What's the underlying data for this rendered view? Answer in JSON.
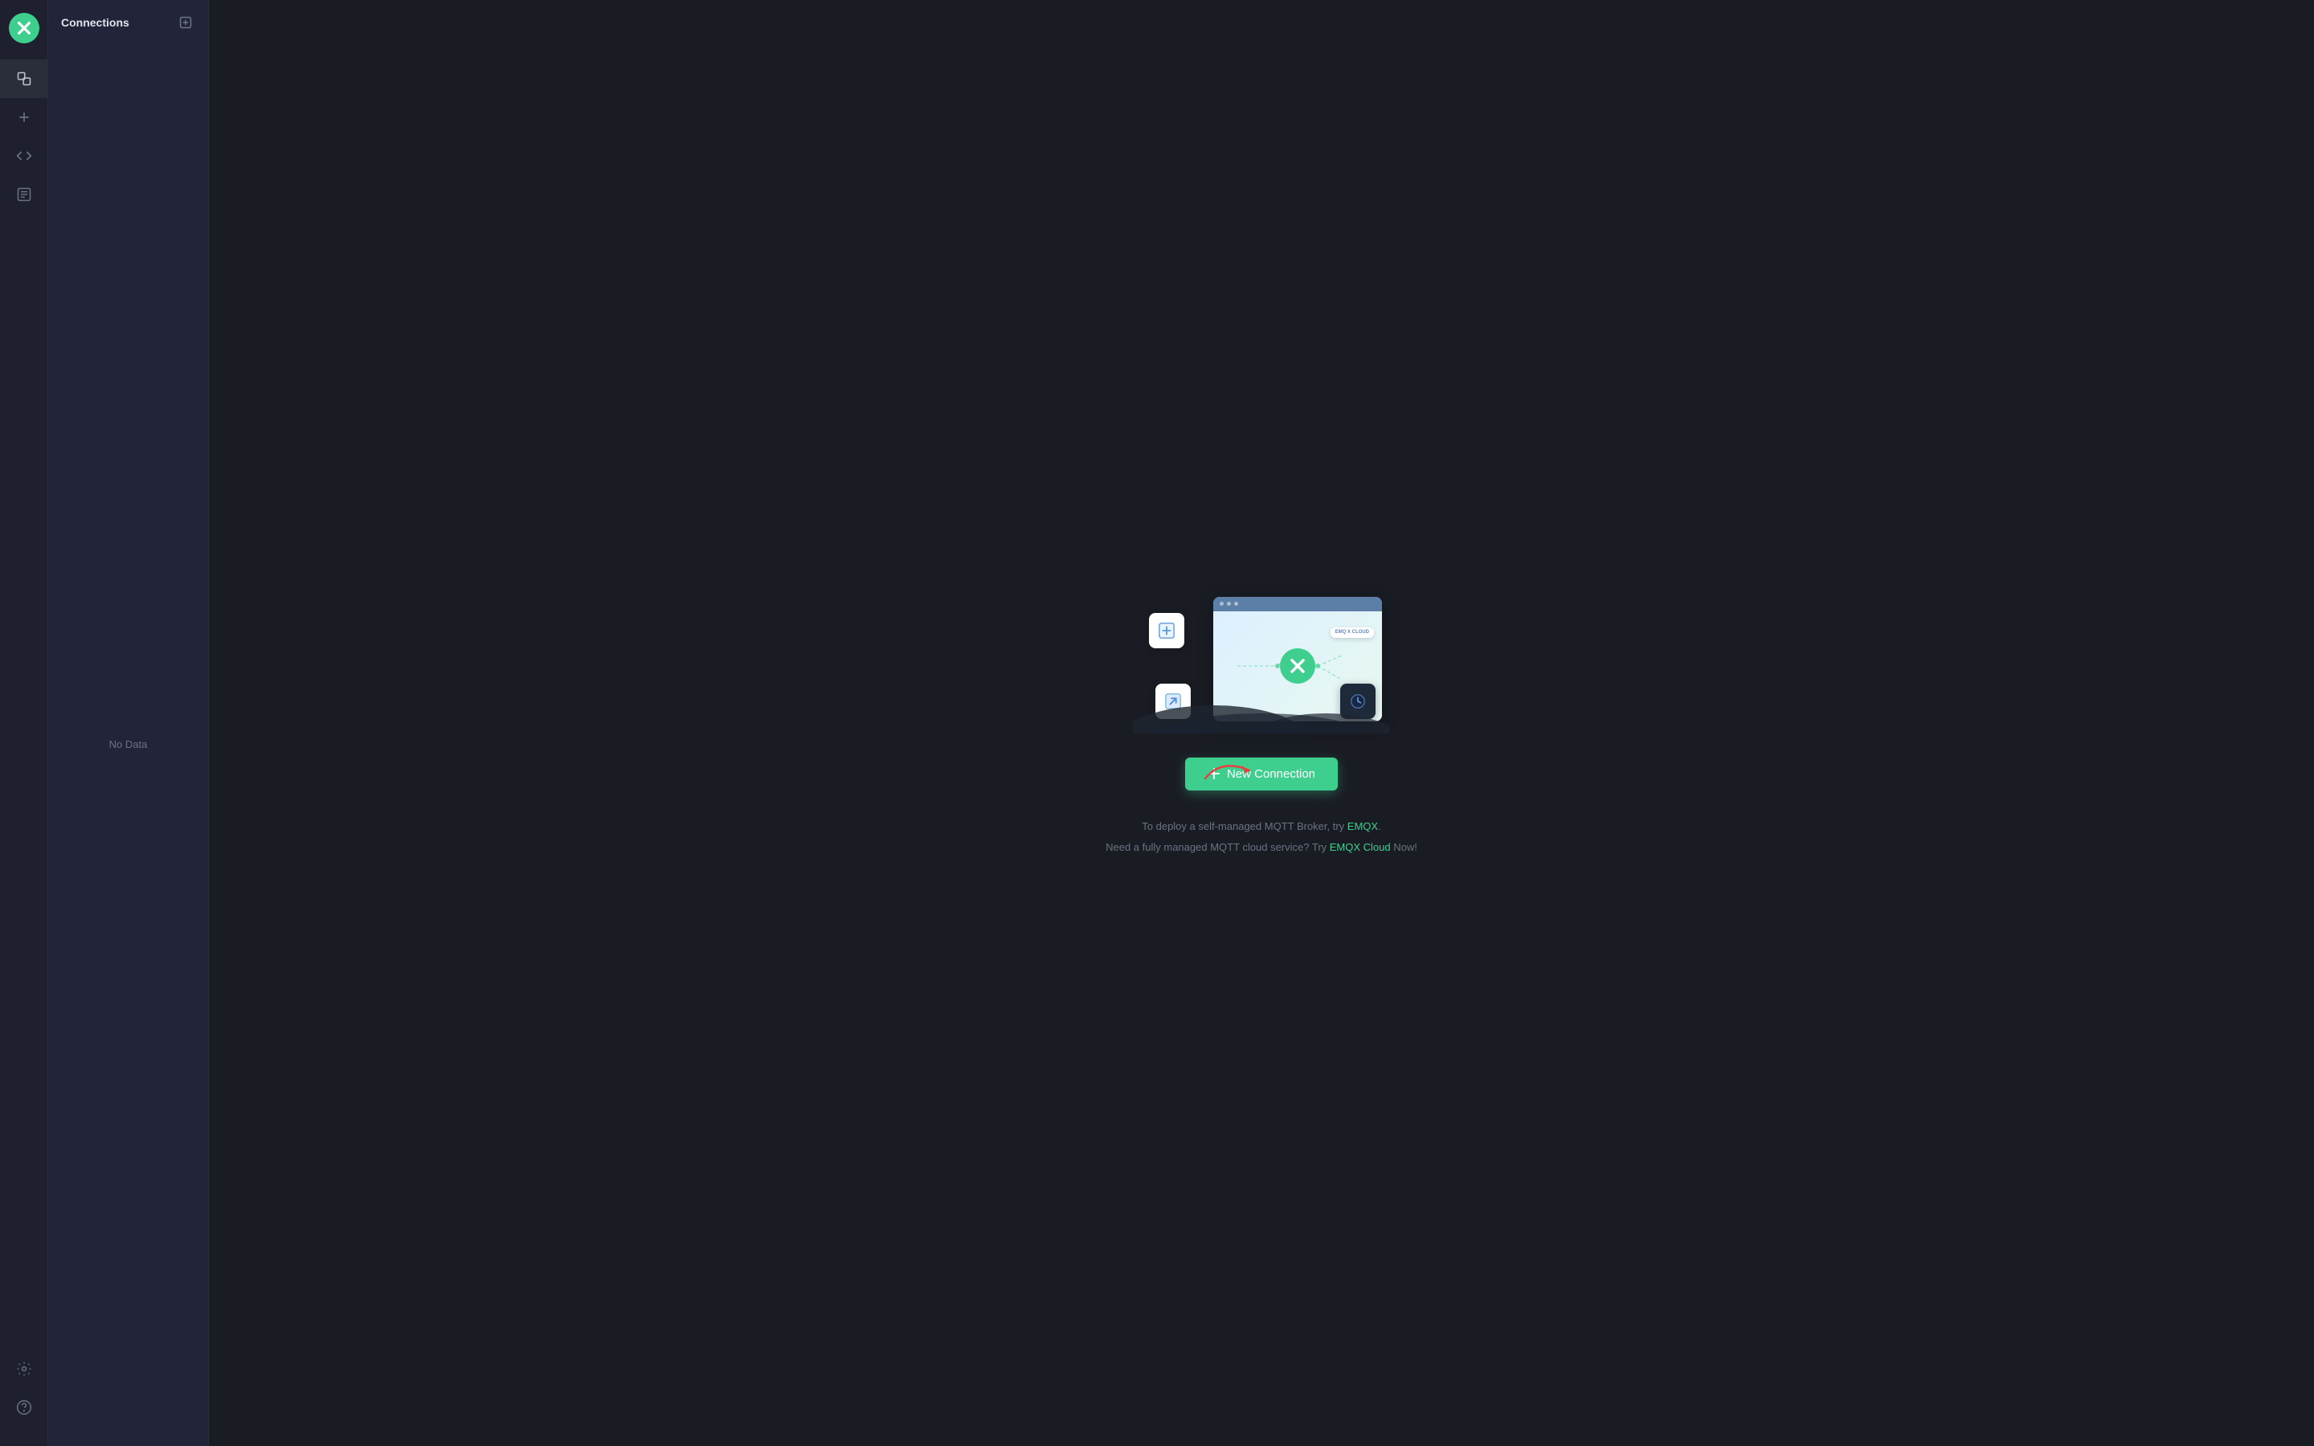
{
  "sidebar": {
    "logo_alt": "MQTTX Logo"
  },
  "connections_panel": {
    "title": "Connections",
    "add_button_label": "+",
    "no_data_text": "No Data"
  },
  "main": {
    "illustration_alt": "MQTT connections illustration",
    "new_connection_button": "+ New Connection",
    "new_connection_label": "New Connection",
    "promo_line1_prefix": "To deploy a self-managed MQTT Broker, try ",
    "promo_line1_link": "EMQX",
    "promo_line1_suffix": ".",
    "promo_line2_prefix": "Need a fully managed MQTT cloud service? Try ",
    "promo_line2_link": "EMQX Cloud",
    "promo_line2_suffix": " Now!"
  },
  "nav_icons": {
    "connections": "connections",
    "add": "add",
    "code": "code",
    "scripts": "scripts",
    "settings": "settings",
    "help": "help"
  },
  "colors": {
    "accent": "#3ecf8e",
    "bg_dark": "#1a1c24",
    "bg_panel": "#22253a",
    "bg_sidebar": "#1e2030",
    "text_muted": "#6b7280",
    "text_main": "#c0c4cc"
  }
}
